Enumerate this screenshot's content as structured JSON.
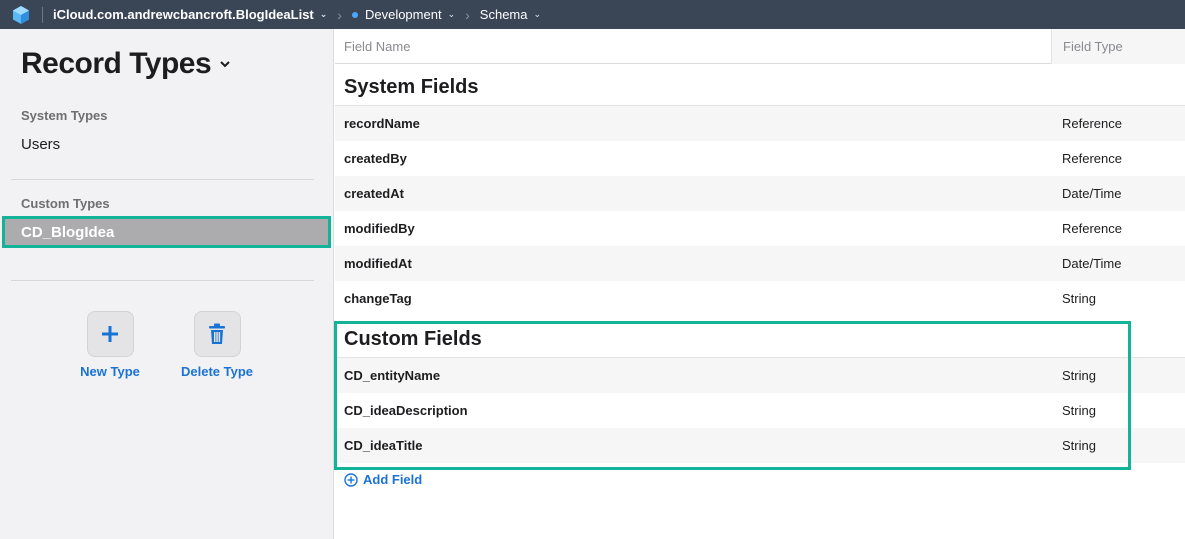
{
  "topbar": {
    "container_name": "iCloud.com.andrewcbancroft.BlogIdeaList",
    "environment": "Development",
    "environment_color": "#4aa8ff",
    "section": "Schema"
  },
  "sidebar": {
    "title": "Record Types",
    "system_label": "System Types",
    "system_items": [
      "Users"
    ],
    "custom_label": "Custom Types",
    "selected_item": "CD_BlogIdea",
    "new_type_label": "New Type",
    "delete_type_label": "Delete Type"
  },
  "table": {
    "col_name": "Field Name",
    "col_type": "Field Type",
    "system_title": "System Fields",
    "system_fields": [
      {
        "name": "recordName",
        "type": "Reference"
      },
      {
        "name": "createdBy",
        "type": "Reference"
      },
      {
        "name": "createdAt",
        "type": "Date/Time"
      },
      {
        "name": "modifiedBy",
        "type": "Reference"
      },
      {
        "name": "modifiedAt",
        "type": "Date/Time"
      },
      {
        "name": "changeTag",
        "type": "String"
      }
    ],
    "custom_title": "Custom Fields",
    "custom_fields": [
      {
        "name": "CD_entityName",
        "type": "String"
      },
      {
        "name": "CD_ideaDescription",
        "type": "String"
      },
      {
        "name": "CD_ideaTitle",
        "type": "String"
      }
    ],
    "add_field_label": "Add Field"
  },
  "colors": {
    "accent": "#1a73d4",
    "highlight": "#13b39a",
    "topbar_bg": "#3a4556"
  }
}
